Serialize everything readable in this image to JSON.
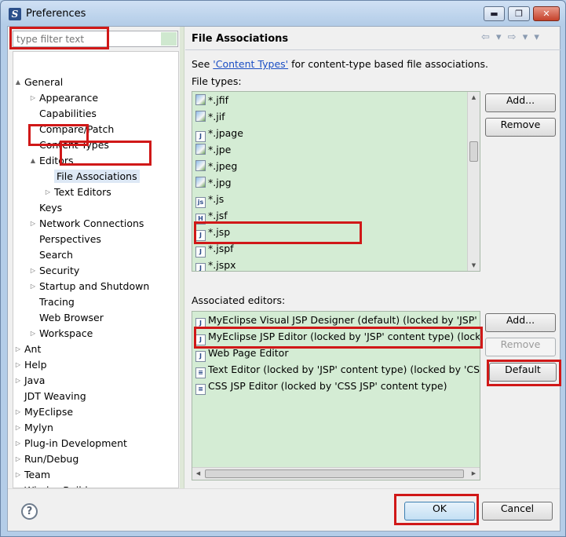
{
  "window": {
    "title": "Preferences",
    "minimize": "▬",
    "maximize": "❐",
    "close": "✕"
  },
  "filter": {
    "placeholder": "type filter text"
  },
  "tree": [
    {
      "label": "General",
      "level": 0,
      "twisty": "▲"
    },
    {
      "label": "Appearance",
      "level": 1,
      "twisty": "▷"
    },
    {
      "label": "Capabilities",
      "level": 1,
      "twisty": ""
    },
    {
      "label": "Compare/Patch",
      "level": 1,
      "twisty": ""
    },
    {
      "label": "Content Types",
      "level": 1,
      "twisty": ""
    },
    {
      "label": "Editors",
      "level": 1,
      "twisty": "▲"
    },
    {
      "label": "File Associations",
      "level": 2,
      "twisty": "",
      "selected": true
    },
    {
      "label": "Text Editors",
      "level": 2,
      "twisty": "▷"
    },
    {
      "label": "Keys",
      "level": 1,
      "twisty": ""
    },
    {
      "label": "Network Connections",
      "level": 1,
      "twisty": "▷"
    },
    {
      "label": "Perspectives",
      "level": 1,
      "twisty": ""
    },
    {
      "label": "Search",
      "level": 1,
      "twisty": ""
    },
    {
      "label": "Security",
      "level": 1,
      "twisty": "▷"
    },
    {
      "label": "Startup and Shutdown",
      "level": 1,
      "twisty": "▷"
    },
    {
      "label": "Tracing",
      "level": 1,
      "twisty": ""
    },
    {
      "label": "Web Browser",
      "level": 1,
      "twisty": ""
    },
    {
      "label": "Workspace",
      "level": 1,
      "twisty": "▷"
    },
    {
      "label": "Ant",
      "level": 0,
      "twisty": "▷"
    },
    {
      "label": "Help",
      "level": 0,
      "twisty": "▷"
    },
    {
      "label": "Java",
      "level": 0,
      "twisty": "▷"
    },
    {
      "label": "JDT Weaving",
      "level": 0,
      "twisty": ""
    },
    {
      "label": "MyEclipse",
      "level": 0,
      "twisty": "▷"
    },
    {
      "label": "Mylyn",
      "level": 0,
      "twisty": "▷"
    },
    {
      "label": "Plug-in Development",
      "level": 0,
      "twisty": "▷"
    },
    {
      "label": "Run/Debug",
      "level": 0,
      "twisty": "▷"
    },
    {
      "label": "Team",
      "level": 0,
      "twisty": "▷"
    },
    {
      "label": "WindowBuilder",
      "level": 0,
      "twisty": "▷"
    }
  ],
  "page": {
    "title": "File Associations",
    "nav": "⇦ ▾ ⇨ ▾ ▾",
    "see_prefix": "See ",
    "see_link": "'Content Types'",
    "see_suffix": " for content-type based file associations.",
    "file_types_label": "File types:",
    "associated_label": "Associated editors:"
  },
  "file_types": [
    {
      "name": "*.jfif",
      "icon": "img"
    },
    {
      "name": "*.jif",
      "icon": "img"
    },
    {
      "name": "*.jpage",
      "icon": "J"
    },
    {
      "name": "*.jpe",
      "icon": "img"
    },
    {
      "name": "*.jpeg",
      "icon": "img"
    },
    {
      "name": "*.jpg",
      "icon": "img"
    },
    {
      "name": "*.js",
      "icon": "js"
    },
    {
      "name": "*.jsf",
      "icon": "H"
    },
    {
      "name": "*.jsp",
      "icon": "J"
    },
    {
      "name": "*.jspf",
      "icon": "J"
    },
    {
      "name": "*.jspx",
      "icon": "J"
    }
  ],
  "editors": [
    {
      "name": "MyEclipse Visual JSP Designer (default) (locked by 'JSP' con",
      "icon": "J"
    },
    {
      "name": "MyEclipse JSP Editor (locked by 'JSP' content type) (locked",
      "icon": "J"
    },
    {
      "name": "Web Page Editor",
      "icon": "J"
    },
    {
      "name": "Text Editor (locked by 'JSP' content type) (locked by 'CSS JS",
      "icon": "≡"
    },
    {
      "name": "CSS JSP Editor (locked by 'CSS JSP' content type)",
      "icon": "≡"
    }
  ],
  "buttons": {
    "add_type": "Add...",
    "remove_type": "Remove",
    "add_editor": "Add...",
    "remove_editor": "Remove",
    "default_editor": "Default",
    "ok": "OK",
    "cancel": "Cancel",
    "help": "?"
  },
  "colors": {
    "highlight": "#d01818",
    "list_bg": "#d4ecd4",
    "link": "#1a4ec4"
  }
}
